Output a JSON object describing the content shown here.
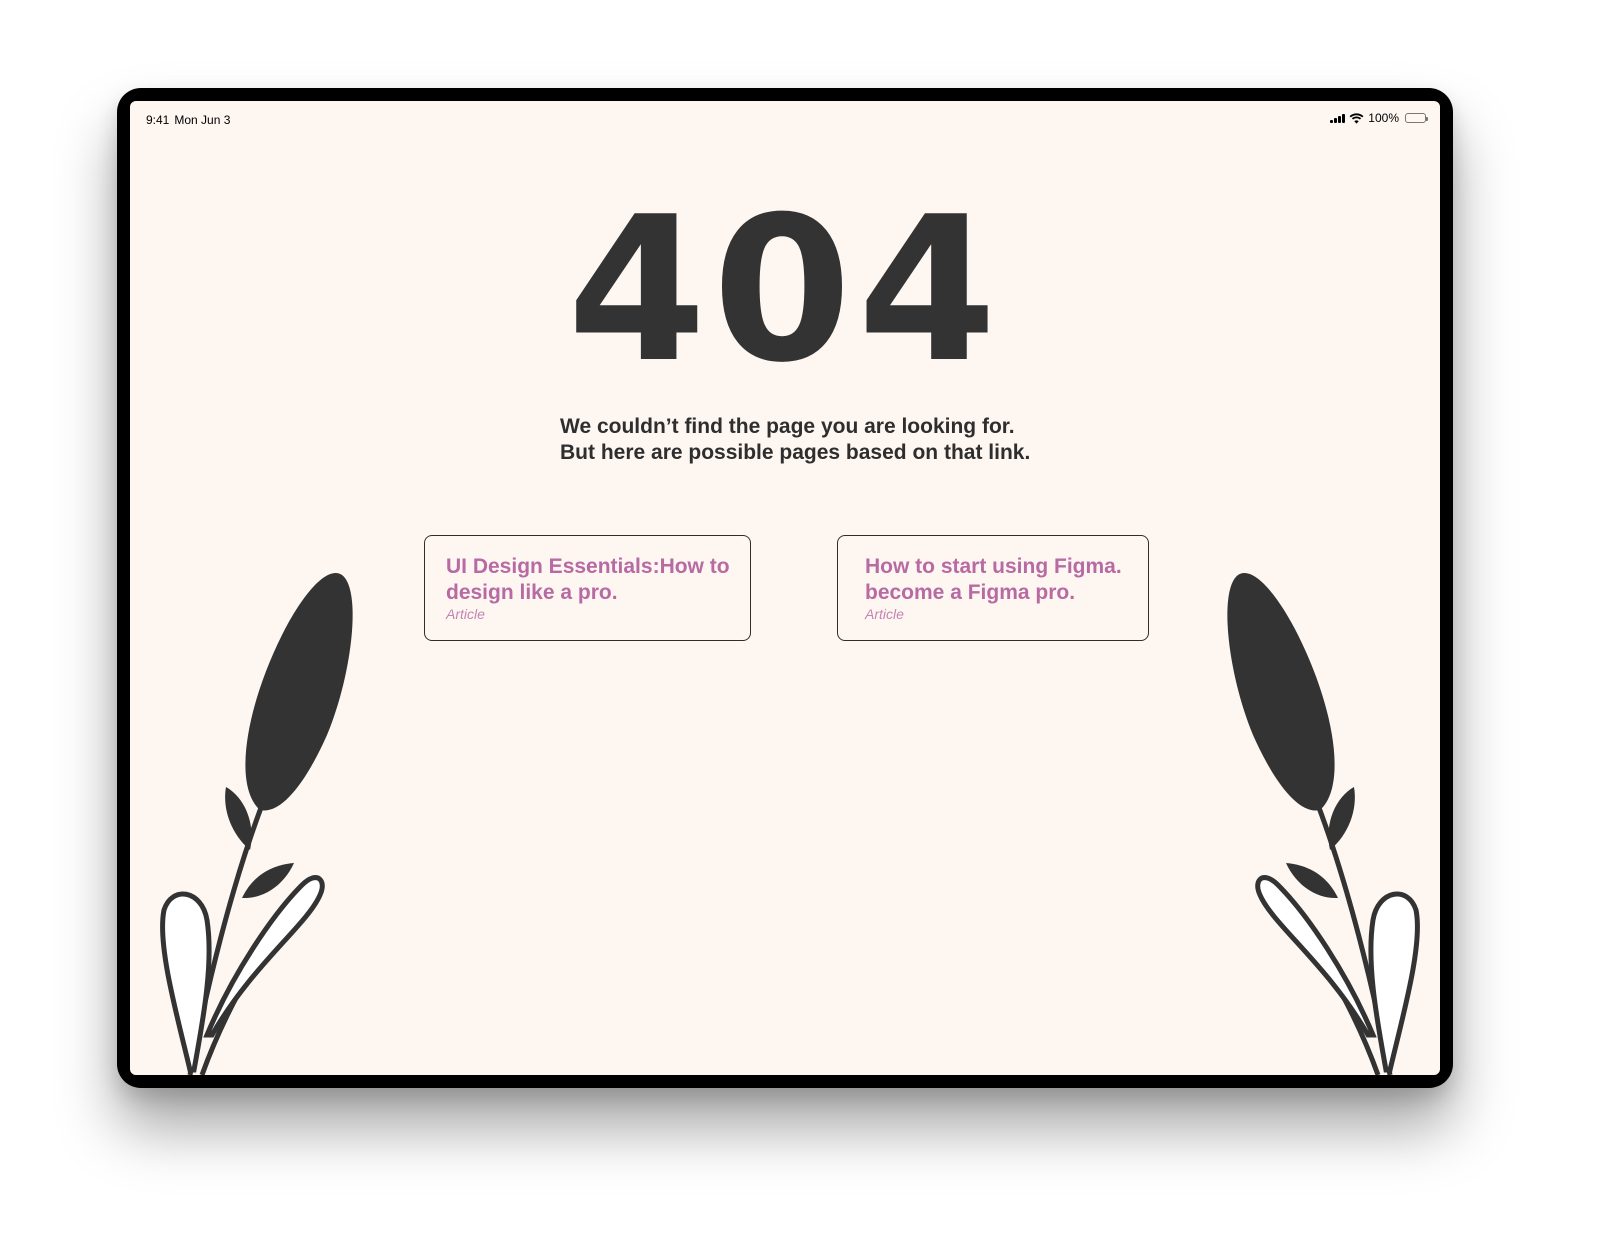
{
  "status_bar": {
    "time": "9:41",
    "date": "Mon Jun 3",
    "battery": "100%"
  },
  "error": {
    "code": "404",
    "message_line1": "We couldn’t find the page you are looking for.",
    "message_line2": "But here are possible pages based on that link."
  },
  "suggestions": [
    {
      "title_line1": "UI Design Essentials:How to",
      "title_line2": "design like a pro.",
      "type": "Article"
    },
    {
      "title_line1": "How to start using Figma.",
      "title_line2": "become a Figma pro.",
      "type": "Article"
    }
  ],
  "colors": {
    "background": "#fdf6f1",
    "text_dark": "#333333",
    "accent": "#b86aa3",
    "bezel": "#000000"
  }
}
